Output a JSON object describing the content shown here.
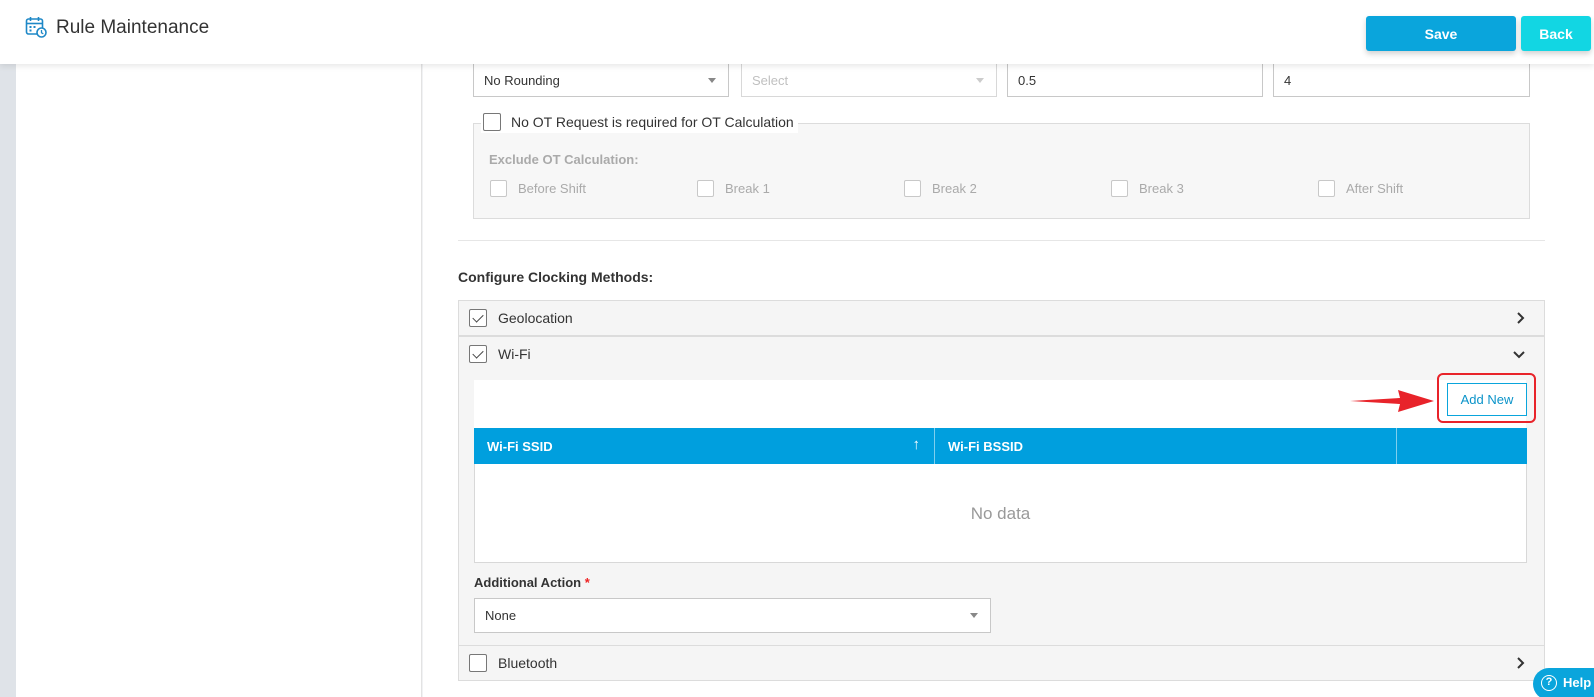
{
  "header": {
    "title": "Rule Maintenance",
    "save_label": "Save",
    "back_label": "Back",
    "icon": "calendar-clock-icon"
  },
  "ot_settings": {
    "rounding_value": "No Rounding",
    "select_placeholder": "Select",
    "value_1": "0.5",
    "value_2": "4",
    "no_ot_request_label": "No OT Request is required for OT Calculation",
    "exclude_title": "Exclude OT Calculation:",
    "exclude_options": [
      "Before Shift",
      "Break 1",
      "Break 2",
      "Break 3",
      "After Shift"
    ]
  },
  "clocking": {
    "title": "Configure Clocking Methods:",
    "methods": [
      {
        "label": "Geolocation",
        "checked": true,
        "expanded": false
      },
      {
        "label": "Wi-Fi",
        "checked": true,
        "expanded": true
      },
      {
        "label": "Bluetooth",
        "checked": false,
        "expanded": false
      }
    ],
    "add_new_label": "Add New",
    "columns": [
      "Wi-Fi SSID",
      "Wi-Fi BSSID",
      ""
    ],
    "sort_icon": "↑",
    "no_data": "No data",
    "additional_action_label": "Additional Action",
    "required_mark": "*",
    "additional_action_value": "None"
  },
  "help": {
    "label": "Help",
    "icon": "?"
  },
  "colors": {
    "accent": "#0aa5dc",
    "back": "#12d6e3",
    "grid_header": "#009fde",
    "highlight": "#e8232a"
  }
}
